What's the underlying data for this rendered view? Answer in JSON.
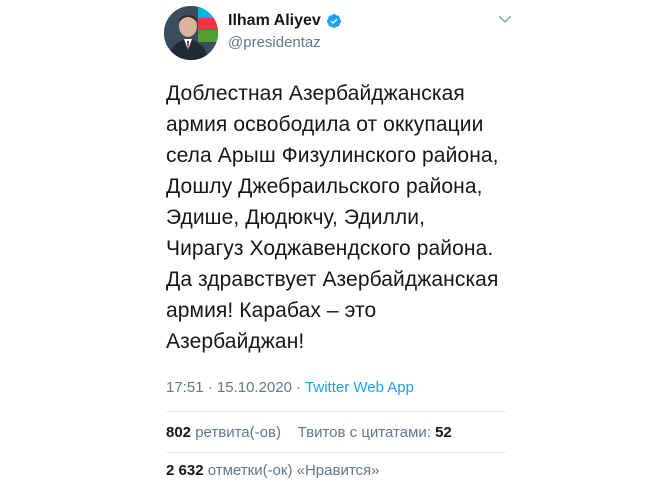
{
  "header": {
    "display_name": "Ilham Aliyev",
    "handle": "@presidentaz"
  },
  "tweet": {
    "text": "Доблестная Азербайджанская\nармия освободила от оккупации\nсела Арыш Физулинского района,\nДошлу Джебраильского района,\nЭдише, Дюдюкчу, Эдилли,\nЧирагуз Ходжавендского района.\nДа здравствует Азербайджанская\nармия! Карабах – это\nАзербайджан!",
    "time": "17:51",
    "separator": " · ",
    "date": "15.10.2020",
    "source": "Twitter Web App"
  },
  "stats": {
    "retweets_count": "802",
    "retweets_label": "ретвита(-ов)",
    "quotes_label": "Твитов с цитатами:",
    "quotes_count": "52",
    "likes_count": "2 632",
    "likes_label": "отметки(-ок) «Нравится»"
  },
  "colors": {
    "accent": "#1da1f2",
    "secondary_text": "#657786",
    "divider": "#e1e8ed"
  }
}
